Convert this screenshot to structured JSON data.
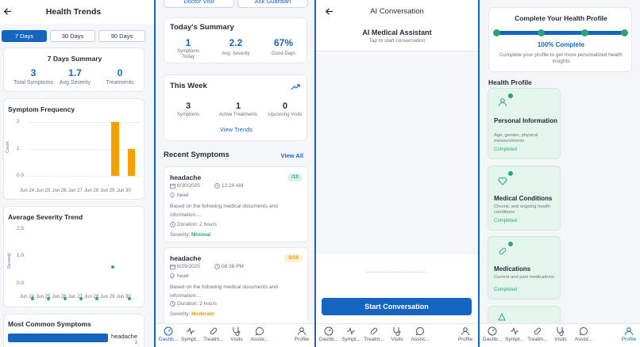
{
  "trends": {
    "title": "Health Trends",
    "ranges": [
      "7 Days",
      "30 Days",
      "90 Days"
    ],
    "summary_title": "7 Days Summary",
    "summary": [
      {
        "value": "3",
        "label": "Total Symptoms"
      },
      {
        "value": "1.7",
        "label": "Avg Severity"
      },
      {
        "value": "0",
        "label": "Treatments"
      }
    ],
    "freq_title": "Symptom Frequency",
    "freq_ylabel": "Count",
    "freq_yticks": [
      "2",
      "1",
      "0.0"
    ],
    "severity_title": "Average Severity Trend",
    "severity_ylabel": "Severity",
    "severity_yticks": [
      "2.5",
      "1.0",
      "0.0"
    ],
    "common_title": "Most Common Symptoms",
    "common_name": "headache",
    "common_count": "3"
  },
  "chart_data": [
    {
      "type": "bar",
      "title": "Symptom Frequency",
      "ylabel": "Count",
      "categories": [
        "Jun 24",
        "Jun 25",
        "Jun 26",
        "Jun 27",
        "Jun 28",
        "Jun 29",
        "Jun 30"
      ],
      "values": [
        0,
        0,
        0,
        0,
        0,
        2,
        1
      ],
      "ylim": [
        0,
        2
      ],
      "color": "#f4a100"
    },
    {
      "type": "scatter",
      "title": "Average Severity Trend",
      "ylabel": "Severity",
      "categories": [
        "Jun 24",
        "Jun 25",
        "Jun 26",
        "Jun 27",
        "Jun 28",
        "Jun 29",
        "Jun 30"
      ],
      "values": [
        0,
        0,
        0,
        0,
        0,
        1.5,
        0
      ],
      "ylim": [
        0,
        2.5
      ],
      "color": "#2aa57a"
    }
  ],
  "dash": {
    "top_buttons": [
      "Doctor Visit",
      "Ask Guardian"
    ],
    "today_title": "Today's Summary",
    "today": [
      {
        "value": "1",
        "label": "Symptoms\nToday"
      },
      {
        "value": "2.2",
        "label": "Avg. Severity"
      },
      {
        "value": "67%",
        "label": "Good Days"
      }
    ],
    "week_title": "This Week",
    "week": [
      {
        "value": "3",
        "label": "Symptoms"
      },
      {
        "value": "1",
        "label": "Active Treatments"
      },
      {
        "value": "0",
        "label": "Upcoming Visits"
      }
    ],
    "view_trends": "View Trends",
    "recent_title": "Recent Symptoms",
    "view_all": "View All",
    "symptoms": [
      {
        "name": "headache",
        "date": "6/30/2025",
        "time": "12:24 AM",
        "location": "head",
        "desc": "Based on the following medical documents and information:...",
        "duration": "Duration: 2 hours",
        "severity_label": "Severity:",
        "severity": "Minimal",
        "score": "/10",
        "color": "#2aa57a",
        "badge_bg": "#dcf3e6"
      },
      {
        "name": "headache",
        "date": "6/29/2025",
        "time": "08:38 PM",
        "location": "head",
        "desc": "Based on the following medical documents and information:...",
        "duration": "Duration: 2 hours",
        "severity_label": "Severity:",
        "severity": "Moderate",
        "score": "5/10",
        "color": "#e3a008",
        "badge_bg": "#fdf0d0"
      }
    ]
  },
  "ai": {
    "title": "AI Conversation",
    "assistant_name": "AI Medical Assistant",
    "hint": "Tap to start conversation",
    "start_button": "Start Conversation"
  },
  "profile": {
    "complete_title": "Complete Your Health Profile",
    "progress": 1.0,
    "complete_pct": "100% Complete",
    "complete_desc": "Complete your profile to get more personalized health insights",
    "section_title": "Health Profile",
    "cards": [
      {
        "icon": "person-icon",
        "title": "Personal Information",
        "desc": "Age, gender, physical measurements",
        "status": "Completed"
      },
      {
        "icon": "heart-icon",
        "title": "Medical Conditions",
        "desc": "Chronic and ongoing health conditions",
        "status": "Completed"
      },
      {
        "icon": "pill-icon",
        "title": "Medications",
        "desc": "Current and past medications",
        "status": "Completed"
      }
    ]
  },
  "nav_common": [
    "Dashb...",
    "Sympt...",
    "Treatm...",
    "Visits",
    "Assist...",
    "Profile"
  ],
  "colors": {
    "primary": "#1565c0",
    "accent_orange": "#f4a100",
    "success": "#2aa57a",
    "warning": "#e3a008"
  }
}
